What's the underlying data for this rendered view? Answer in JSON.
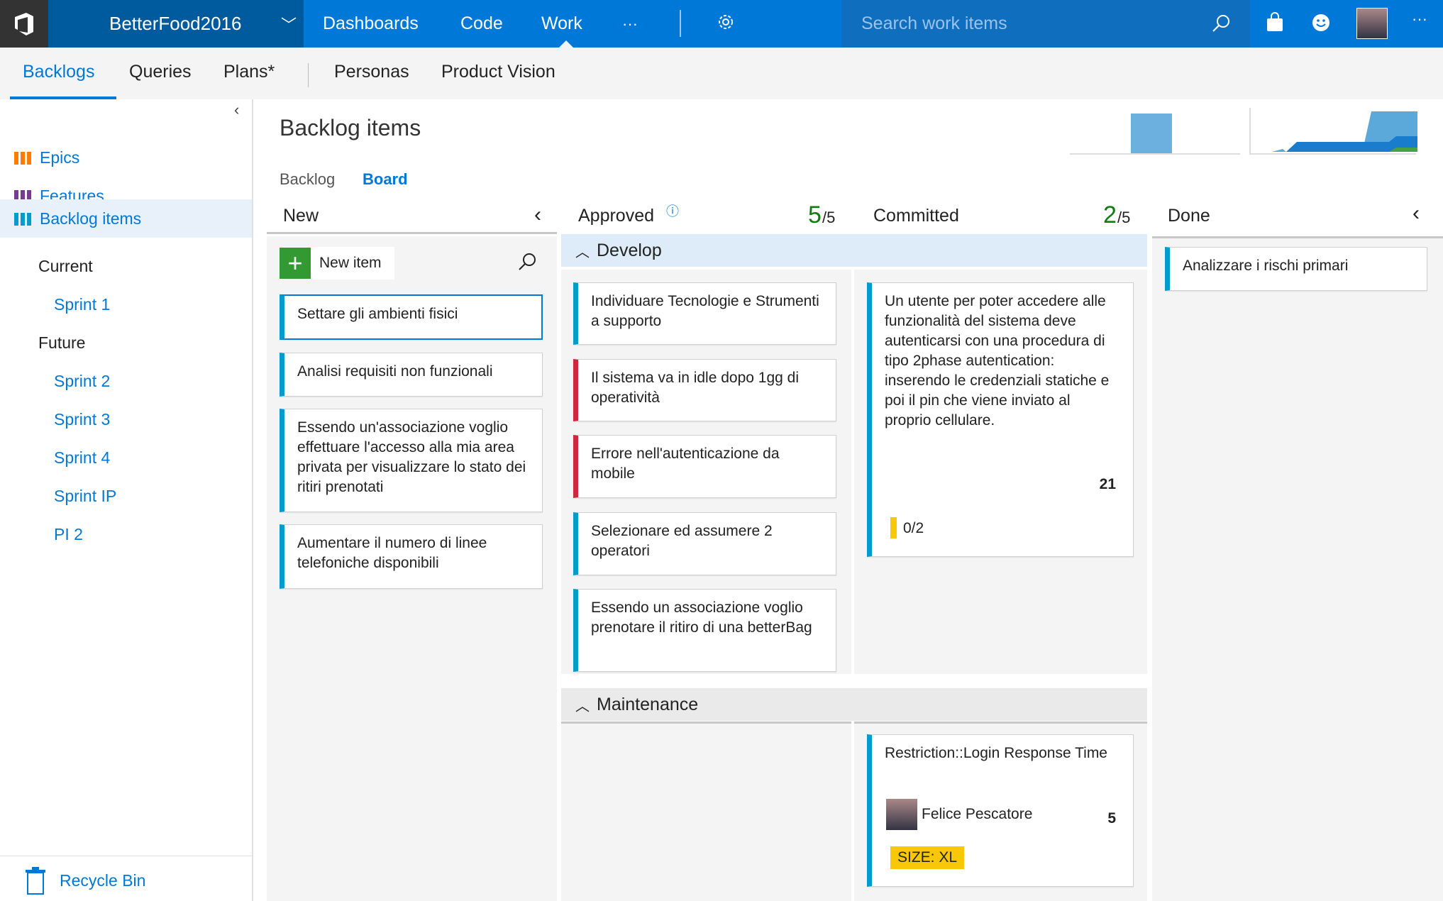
{
  "topbar": {
    "project": "BetterFood2016",
    "nav": [
      "Dashboards",
      "Code",
      "Work"
    ],
    "more": "···",
    "search_placeholder": "Search work items",
    "right_more": "···"
  },
  "subnav": {
    "tabs": [
      "Backlogs",
      "Queries",
      "Plans*",
      "Personas",
      "Product Vision"
    ],
    "active": "Backlogs"
  },
  "sidebar": {
    "items": [
      {
        "label": "Epics",
        "color": "#ff7b00"
      },
      {
        "label": "Features",
        "color": "#773b93"
      },
      {
        "label": "Backlog items",
        "color": "#009ccc"
      }
    ],
    "current_label": "Current",
    "current": [
      "Sprint 1"
    ],
    "future_label": "Future",
    "future": [
      "Sprint 2",
      "Sprint 3",
      "Sprint 4",
      "Sprint IP",
      "PI 2"
    ],
    "recycle": "Recycle Bin"
  },
  "page": {
    "title": "Backlog items",
    "views": [
      "Backlog",
      "Board"
    ],
    "active_view": "Board"
  },
  "board": {
    "columns": [
      {
        "name": "New"
      },
      {
        "name": "Approved",
        "count": "5",
        "limit": "/5"
      },
      {
        "name": "Committed",
        "count": "2",
        "limit": "/5"
      },
      {
        "name": "Done"
      }
    ],
    "new_item": "New item",
    "new_cards": [
      "Settare gli ambienti fisici",
      "Analisi requisiti non funzionali",
      "Essendo un'associazione voglio effettuare l'accesso alla mia area privata per visualizzare lo stato dei ritiri prenotati",
      "Aumentare il numero di linee telefoniche disponibili"
    ],
    "lanes": [
      "Develop",
      "Maintenance"
    ],
    "approved_cards": [
      {
        "title": "Individuare Tecnologie e Strumenti a supporto",
        "type": "pbi"
      },
      {
        "title": "Il sistema va in idle dopo 1gg di operatività",
        "type": "bug"
      },
      {
        "title": "Errore nell'autenticazione da mobile",
        "type": "bug"
      },
      {
        "title": "Selezionare ed assumere 2 operatori",
        "type": "pbi"
      },
      {
        "title": "Essendo un associazione voglio prenotare il ritiro di una betterBag",
        "type": "pbi"
      }
    ],
    "committed_card": {
      "title": "Un utente per poter accedere alle funzionalità del sistema deve autenticarsi con una procedura di tipo 2phase autentication: inserendo le credenziali statiche e poi il pin che viene inviato al proprio cellulare.",
      "effort": "21",
      "tasks": "0/2"
    },
    "maintenance_card": {
      "title": "Restriction::Login Response Time",
      "assignee": "Felice Pescatore",
      "effort": "5",
      "tag": "SIZE: XL"
    },
    "done_cards": [
      "Analizzare i rischi primari"
    ]
  }
}
